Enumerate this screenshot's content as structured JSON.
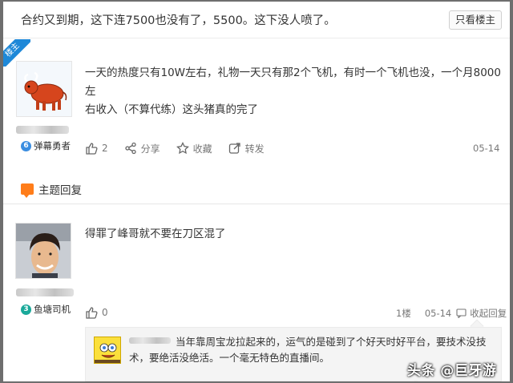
{
  "topic": {
    "title": "合约又到期，这下连7500也没有了，5500。这下没人喷了。",
    "only_host_label": "只看楼主"
  },
  "post1": {
    "host_tag": "楼主",
    "level": "6",
    "level_color": "#3a8de0",
    "badge": "弹幕勇者",
    "text_line1": "一天的热度只有10W左右，礼物一天只有那2个飞机，有时一个飞机也没，一个月8000左",
    "text_line2": "右收入（不算代练）这头猪真的完了",
    "likes": "2",
    "share_label": "分享",
    "fav_label": "收藏",
    "forward_label": "转发",
    "date": "05-14"
  },
  "section": {
    "title": "主题回复"
  },
  "post2": {
    "level": "3",
    "level_color": "#1aa99a",
    "badge": "鱼塘司机",
    "text": "得罪了峰哥就不要在刀区混了",
    "likes": "0",
    "floor": "1楼",
    "date": "05-14",
    "collapse_label": "收起回复",
    "reply": {
      "text_line1": "当年靠周宝龙拉起来的，运气的是碰到了个好天时好平台，要技术没技",
      "text_line2": "术，要绝活没绝活。一个毫无特色的直播间。"
    }
  },
  "watermark": "头条 @巨牙游戏"
}
